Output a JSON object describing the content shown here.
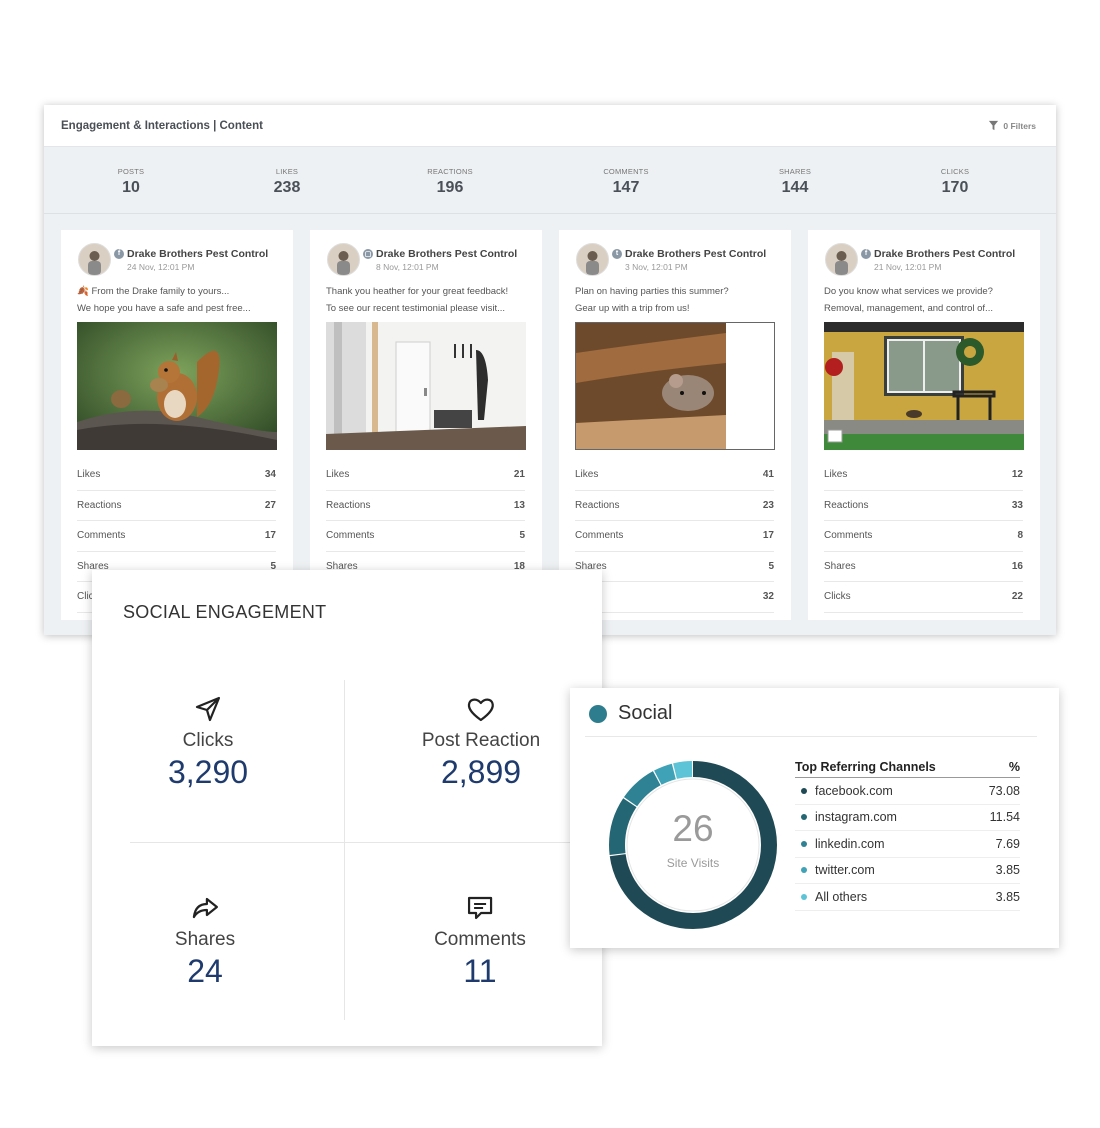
{
  "dashboard": {
    "title": "Engagement & Interactions | Content",
    "filters_label": "0 Filters",
    "stats": [
      {
        "label": "POSTS",
        "value": "10"
      },
      {
        "label": "LIKES",
        "value": "238"
      },
      {
        "label": "REACTIONS",
        "value": "196"
      },
      {
        "label": "COMMENTS",
        "value": "147"
      },
      {
        "label": "SHARES",
        "value": "144"
      },
      {
        "label": "CLICKS",
        "value": "170"
      }
    ],
    "posts": [
      {
        "author": "Drake Brothers Pest Control",
        "source_icon": "facebook-icon",
        "date": "24 Nov, 12:01 PM",
        "line1": "From the Drake family to yours...",
        "line2": "We hope you have a safe and pest free...",
        "image": "squirrel-photo",
        "metrics": [
          {
            "label": "Likes",
            "value": "34"
          },
          {
            "label": "Reactions",
            "value": "27"
          },
          {
            "label": "Comments",
            "value": "17"
          },
          {
            "label": "Shares",
            "value": "5"
          },
          {
            "label": "Clicks",
            "value": ""
          }
        ]
      },
      {
        "author": "Drake Brothers Pest Control",
        "source_icon": "google-business-icon",
        "date": "8 Nov, 12:01 PM",
        "line1": "Thank you heather for your great feedback!",
        "line2": "To see our recent testimonial please visit...",
        "image": "hallway-photo",
        "metrics": [
          {
            "label": "Likes",
            "value": "21"
          },
          {
            "label": "Reactions",
            "value": "13"
          },
          {
            "label": "Comments",
            "value": "5"
          },
          {
            "label": "Shares",
            "value": "18"
          }
        ]
      },
      {
        "author": "Drake Brothers Pest Control",
        "source_icon": "twitter-icon",
        "date": "3 Nov, 12:01 PM",
        "line1": "Plan on having parties this summer?",
        "line2": "Gear up with a trip from us!",
        "image": "mouse-photo",
        "metrics": [
          {
            "label": "Likes",
            "value": "41"
          },
          {
            "label": "Reactions",
            "value": "23"
          },
          {
            "label": "Comments",
            "value": "17"
          },
          {
            "label": "Shares",
            "value": "5"
          },
          {
            "label": "",
            "value": "32"
          }
        ]
      },
      {
        "author": "Drake Brothers Pest Control",
        "source_icon": "facebook-icon",
        "date": "21 Nov, 12:01 PM",
        "line1": "Do you know what services we provide?",
        "line2": "Removal, management, and control of...",
        "image": "house-porch-photo",
        "metrics": [
          {
            "label": "Likes",
            "value": "12"
          },
          {
            "label": "Reactions",
            "value": "33"
          },
          {
            "label": "Comments",
            "value": "8"
          },
          {
            "label": "Shares",
            "value": "16"
          },
          {
            "label": "Clicks",
            "value": "22"
          }
        ]
      }
    ]
  },
  "social_engagement": {
    "title": "SOCIAL ENGAGEMENT",
    "cells": [
      {
        "icon": "send-arrow-icon",
        "label": "Clicks",
        "value": "3,290"
      },
      {
        "icon": "heart-icon",
        "label": "Post Reaction",
        "value": "2,899"
      },
      {
        "icon": "share-arrow-icon",
        "label": "Shares",
        "value": "24"
      },
      {
        "icon": "comment-icon",
        "label": "Comments",
        "value": "11"
      }
    ]
  },
  "social": {
    "title": "Social",
    "accent_color": "#2d7d8e",
    "center_value": "26",
    "center_label": "Site Visits",
    "table_header": {
      "name": "Top Referring Channels",
      "pct": "%"
    },
    "channels": [
      {
        "name": "facebook.com",
        "pct": "73.08",
        "color": "#1f4a55"
      },
      {
        "name": "instagram.com",
        "pct": "11.54",
        "color": "#246673"
      },
      {
        "name": "linkedin.com",
        "pct": "7.69",
        "color": "#2e8294"
      },
      {
        "name": "twitter.com",
        "pct": "3.85",
        "color": "#3fa2b6"
      },
      {
        "name": "All others",
        "pct": "3.85",
        "color": "#5cc4d6"
      }
    ]
  }
}
